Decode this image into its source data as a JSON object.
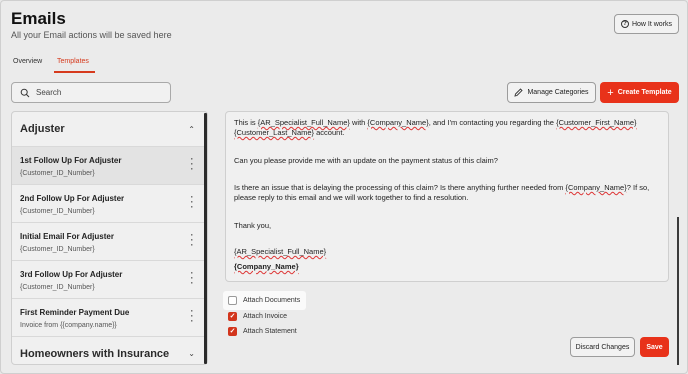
{
  "page": {
    "title": "Emails",
    "subtitle": "All your Email actions will be saved here",
    "how_it_works": "How It works"
  },
  "tabs": [
    {
      "label": "Overview",
      "active": false
    },
    {
      "label": "Templates",
      "active": true
    }
  ],
  "toolbar": {
    "search_placeholder": "Search",
    "manage_categories": "Manage Categories",
    "create_template": "Create Template"
  },
  "sidebar": {
    "groups": [
      {
        "name": "Adjuster",
        "expanded": true,
        "items": [
          {
            "name": "1st Follow Up For Adjuster",
            "sub": "{Customer_ID_Number}",
            "active": true
          },
          {
            "name": "2nd Follow Up For Adjuster",
            "sub": "{Customer_ID_Number}",
            "active": false
          },
          {
            "name": "Initial Email For Adjuster",
            "sub": "{Customer_ID_Number}",
            "active": false
          },
          {
            "name": "3rd Follow Up For Adjuster",
            "sub": "{Customer_ID_Number}",
            "active": false
          },
          {
            "name": "First Reminder Payment Due",
            "sub": "Invoice from {{company.name}}",
            "active": false
          }
        ]
      },
      {
        "name": "Homeowners with Insurance",
        "expanded": false,
        "items": []
      }
    ]
  },
  "editor": {
    "para1": {
      "t1": "This is ",
      "v1": "{AR_Specialist_Full_Name}",
      "t2": " with ",
      "v2": "{Company_Name}",
      "t3": ", and I'm contacting you regarding the ",
      "v3": "{Customer_First_Name}",
      "t4": " ",
      "v4": "{Customer_Last_Name}",
      "t5": " account."
    },
    "para2": "Can you please provide me with an update on the payment status of this claim?",
    "para3": {
      "t1": "Is there an issue that is delaying the processing of this claim? Is there anything further needed from ",
      "v1": "{Company_Name}",
      "t2": "? If so, please reply to this email and we will work together to find a resolution."
    },
    "para4": "Thank you,",
    "sig_name": "{AR_Specialist_Full_Name}",
    "sig_company": "{Company_Name}"
  },
  "attachments": {
    "documents": {
      "label": "Attach Documents",
      "checked": false
    },
    "invoice": {
      "label": "Attach Invoice",
      "checked": true
    },
    "statement": {
      "label": "Attach Statement",
      "checked": true
    }
  },
  "footer": {
    "discard": "Discard Changes",
    "save": "Save"
  },
  "colors": {
    "accent": "#e8321a",
    "background": "#ebebeb"
  }
}
